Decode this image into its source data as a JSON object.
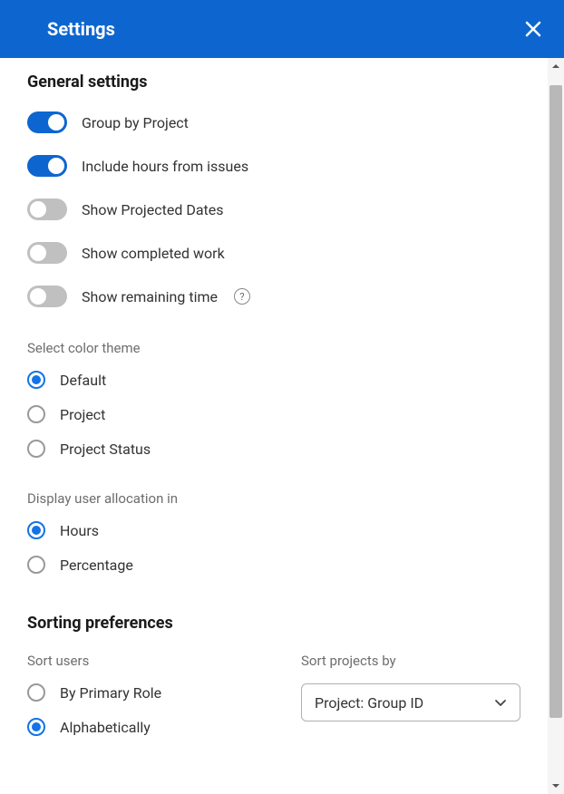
{
  "header": {
    "title": "Settings"
  },
  "general": {
    "title": "General settings",
    "toggles": [
      {
        "label": "Group by Project",
        "on": true
      },
      {
        "label": "Include hours from issues",
        "on": true
      },
      {
        "label": "Show Projected Dates",
        "on": false
      },
      {
        "label": "Show completed work",
        "on": false
      },
      {
        "label": "Show remaining time",
        "on": false,
        "help": true
      }
    ],
    "colorTheme": {
      "label": "Select color theme",
      "options": [
        {
          "label": "Default",
          "selected": true
        },
        {
          "label": "Project",
          "selected": false
        },
        {
          "label": "Project Status",
          "selected": false
        }
      ]
    },
    "allocation": {
      "label": "Display user allocation in",
      "options": [
        {
          "label": "Hours",
          "selected": true
        },
        {
          "label": "Percentage",
          "selected": false
        }
      ]
    }
  },
  "sorting": {
    "title": "Sorting preferences",
    "users": {
      "label": "Sort users",
      "options": [
        {
          "label": "By Primary Role",
          "selected": false
        },
        {
          "label": "Alphabetically",
          "selected": true
        }
      ]
    },
    "projects": {
      "label": "Sort projects by",
      "selected": "Project: Group ID"
    }
  }
}
